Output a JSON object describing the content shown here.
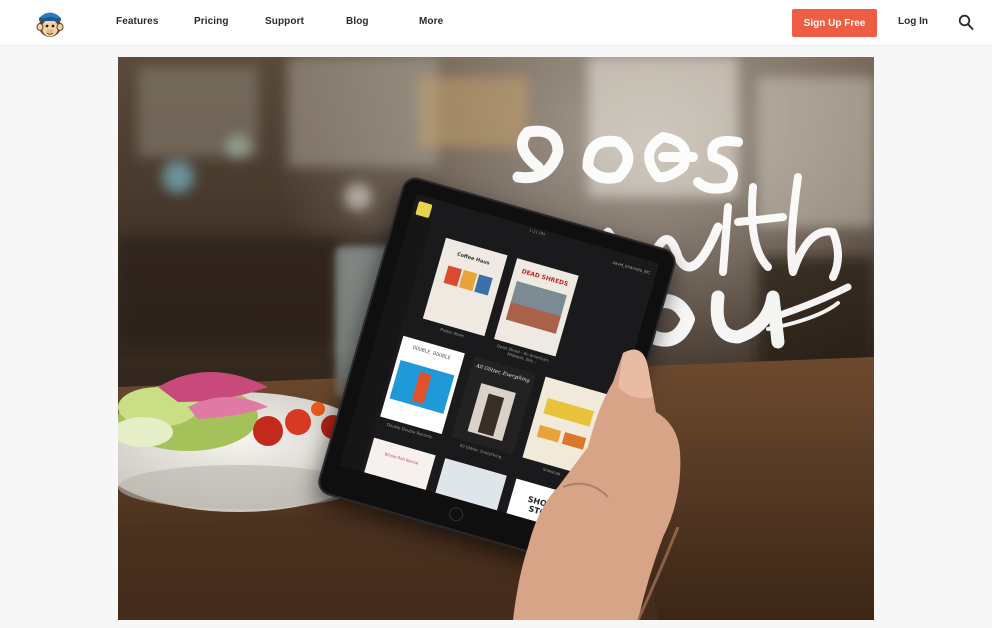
{
  "header": {
    "logo_icon": "freddie-monkey-icon",
    "nav": [
      "Features",
      "Pricing",
      "Support",
      "Blog",
      "More"
    ],
    "signup_label": "Sign Up Free",
    "login_label": "Log In",
    "search_icon": "search-icon"
  },
  "colors": {
    "accent": "#ef5d44",
    "page_bg": "#f7f7f7",
    "nav_text": "#2b2b2b"
  },
  "hero": {
    "headline_art": "goes with you",
    "tablet": {
      "status_time": "1:21 PM",
      "account": "david_kitamoto_MC",
      "cards": [
        {
          "title": "Coffee Haus",
          "caption": "Poster Store"
        },
        {
          "title": "DEAD SHREDS",
          "caption": "Dead Shred - An American, Midwest, Ska..."
        },
        {
          "title": "DOUBLE DOUBLE",
          "caption": "Double Double Records"
        },
        {
          "title": "All Glitter, Everything",
          "caption": "All Glitter, Everything"
        },
        {
          "title": "",
          "caption": "Snowcap"
        },
        {
          "title": "Whole Roll Rental",
          "caption": ""
        },
        {
          "title": "",
          "caption": ""
        },
        {
          "title": "SHORT STOP",
          "caption": ""
        }
      ]
    }
  }
}
